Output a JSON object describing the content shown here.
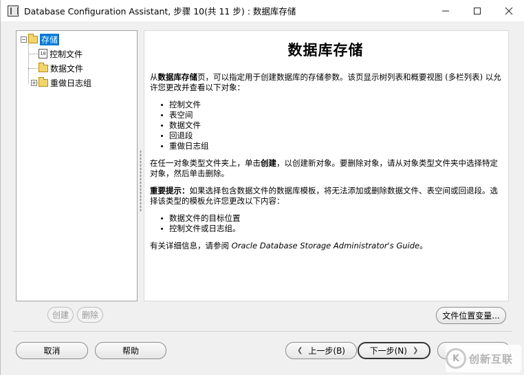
{
  "window": {
    "title": "Database Configuration Assistant, 步骤 10(共 11 步) : 数据库存储",
    "controls": [
      "minimize-icon",
      "maximize-icon",
      "close-icon"
    ]
  },
  "tree": {
    "root": {
      "label": "存储",
      "expanded": true,
      "selected": true
    },
    "children": [
      {
        "label": "控制文件",
        "icon": "document-icon"
      },
      {
        "label": "数据文件",
        "icon": "folder-icon"
      },
      {
        "label": "重做日志组",
        "icon": "folder-icon",
        "expandable": true
      }
    ]
  },
  "content": {
    "title": "数据库存储",
    "intro_prefix": "从",
    "intro_bold": "数据库存储",
    "intro_rest": "页，可以指定用于创建数据库的存储参数。该页显示树列表和概要视图 (多栏列表) 以允许您更改并查看以下对象：",
    "objects": [
      "控制文件",
      "表空间",
      "数据文件",
      "回退段",
      "重做日志组"
    ],
    "create_prefix": "在任一对象类型文件夹上，单击",
    "create_bold": "创建",
    "create_rest": "，以创建新对象。要删除对象，请从对象类型文件夹中选择特定对象，然后单击删除。",
    "important_bold": "重要提示：",
    "important_rest": "如果选择包含数据文件的数据库模板，将无法添加或删除数据文件、表空间或回退段。选择该类型的模板允许您更改以下内容：",
    "changeable": [
      "数据文件的目标位置",
      "控制文件或日志组。"
    ],
    "more_prefix": "有关详细信息，请参阅 ",
    "more_italic": "Oracle Database Storage Administrator's Guide",
    "more_suffix": "。"
  },
  "buttons": {
    "create": "创建",
    "delete": "删除",
    "file_location": "文件位置变量...",
    "cancel": "取消",
    "help": "帮助",
    "back": "上一步(B)",
    "next": "下一步(N)"
  },
  "watermark": {
    "text": "创新互联",
    "logo": "K"
  },
  "colors": {
    "selection": "#0078d7",
    "window_bg": "#f0f0f0"
  }
}
